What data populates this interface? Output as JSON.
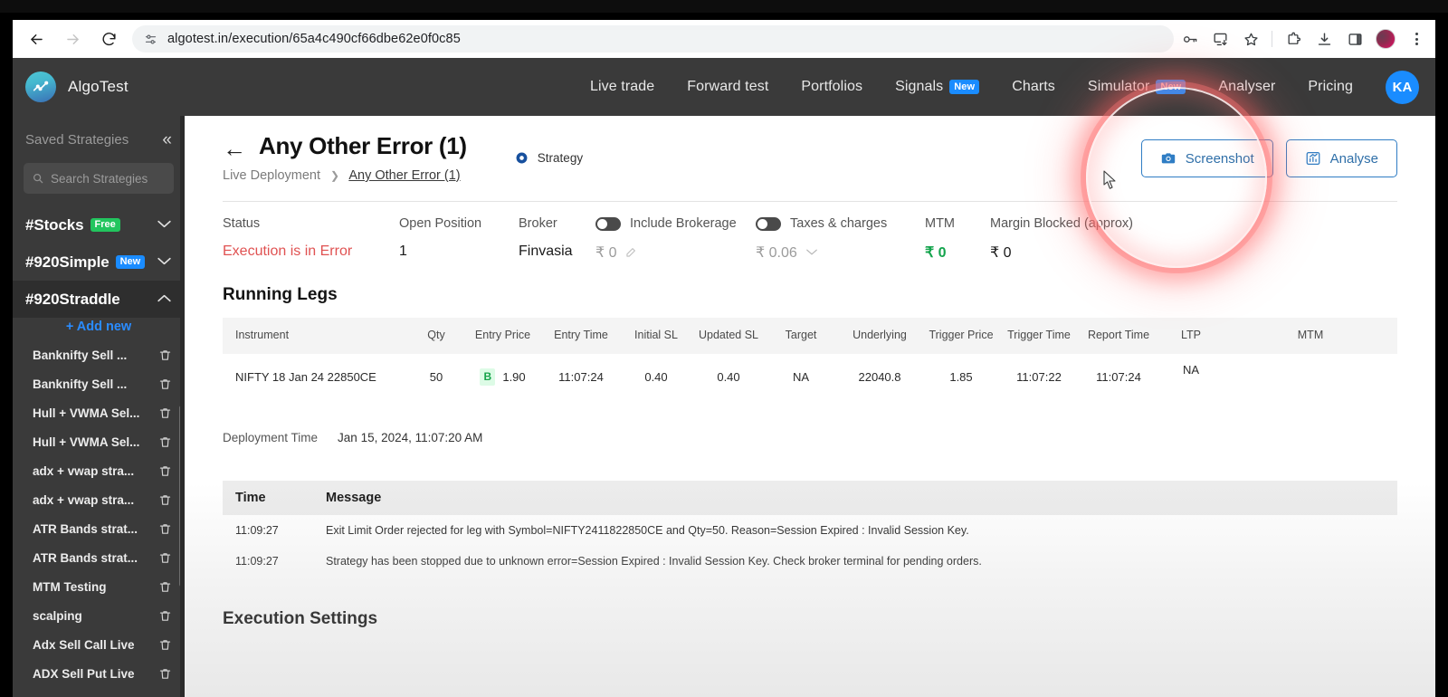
{
  "browser": {
    "url": "algotest.in/execution/65a4c490cf66dbe62e0f0c85",
    "back_icon": "back-arrow-icon",
    "forward_icon": "forward-arrow-icon",
    "reload_icon": "reload-icon",
    "site_info_icon": "site-settings-icon",
    "toolbar_icons": [
      "password-key-icon",
      "install-app-icon",
      "bookmark-star-icon",
      "extensions-puzzle-icon",
      "downloads-icon",
      "side-panel-icon",
      "profile-avatar-icon",
      "kebab-menu-icon"
    ]
  },
  "appnav": {
    "brand": "AlgoTest",
    "links": [
      {
        "label": "Live trade",
        "badge": ""
      },
      {
        "label": "Forward test",
        "badge": ""
      },
      {
        "label": "Portfolios",
        "badge": ""
      },
      {
        "label": "Signals",
        "badge": "New"
      },
      {
        "label": "Charts",
        "badge": ""
      },
      {
        "label": "Simulator",
        "badge": "New"
      },
      {
        "label": "Analyser",
        "badge": ""
      },
      {
        "label": "Pricing",
        "badge": ""
      }
    ],
    "avatar_initials": "KA"
  },
  "sidebar": {
    "title": "Saved Strategies",
    "collapse_glyph": "«",
    "search_placeholder": "Search Strategies",
    "groups": [
      {
        "label": "#Stocks",
        "badge": "Free",
        "badge_color": "#22c55e",
        "expanded": false
      },
      {
        "label": "#920Simple",
        "badge": "New",
        "badge_color": "#1a8cff",
        "expanded": false
      },
      {
        "label": "#920Straddle",
        "badge": "",
        "badge_color": "",
        "expanded": true
      }
    ],
    "add_new_label": "+ Add new",
    "items": [
      {
        "label": "Banknifty Sell ..."
      },
      {
        "label": "Banknifty Sell ..."
      },
      {
        "label": "Hull + VWMA Sel..."
      },
      {
        "label": "Hull + VWMA Sel..."
      },
      {
        "label": "adx + vwap stra..."
      },
      {
        "label": "adx + vwap stra..."
      },
      {
        "label": "ATR Bands strat..."
      },
      {
        "label": "ATR Bands strat..."
      },
      {
        "label": "MTM Testing"
      },
      {
        "label": "scalping"
      },
      {
        "label": "Adx Sell Call Live"
      },
      {
        "label": "ADX Sell Put Live"
      }
    ]
  },
  "header": {
    "back_glyph": "←",
    "title": "Any Other Error (1)",
    "breadcrumb_root": "Live Deployment",
    "breadcrumb_sep": "❯",
    "breadcrumb_current": "Any Other Error (1)",
    "strategy_tag": "Strategy",
    "screenshot_button": "Screenshot",
    "analyse_button": "Analyse",
    "accent_color": "#2f7dc4"
  },
  "stats": [
    {
      "name": "status",
      "label": "Status",
      "value": "Execution is in Error",
      "style": "err",
      "toggle": false,
      "pencil": false,
      "caret": false
    },
    {
      "name": "open-position",
      "label": "Open Position",
      "value": "1",
      "style": "",
      "toggle": false,
      "pencil": false,
      "caret": false
    },
    {
      "name": "broker",
      "label": "Broker",
      "value": "Finvasia",
      "style": "",
      "toggle": false,
      "pencil": false,
      "caret": false
    },
    {
      "name": "include-brokerage",
      "label": "Include Brokerage",
      "value": "₹ 0",
      "style": "muted",
      "toggle": true,
      "pencil": true,
      "caret": false
    },
    {
      "name": "taxes-charges",
      "label": "Taxes & charges",
      "value": "₹ 0.06",
      "style": "muted",
      "toggle": true,
      "pencil": false,
      "caret": true
    },
    {
      "name": "mtm",
      "label": "MTM",
      "value": "₹ 0",
      "style": "pos",
      "toggle": false,
      "pencil": false,
      "caret": false
    },
    {
      "name": "margin-blocked",
      "label": "Margin Blocked (approx)",
      "value": "₹ 0",
      "style": "",
      "toggle": false,
      "pencil": false,
      "caret": false
    }
  ],
  "running_legs": {
    "section_title": "Running Legs",
    "columns": [
      "Instrument",
      "Qty",
      "Entry Price",
      "Entry Time",
      "Initial SL",
      "Updated SL",
      "Target",
      "Underlying",
      "Trigger Price",
      "Trigger Time",
      "Report Time",
      "LTP",
      "MTM"
    ],
    "rows": [
      {
        "instrument": "NIFTY 18 Jan 24 22850CE",
        "qty": "50",
        "side": "B",
        "entry_price": "1.90",
        "entry_time": "11:07:24",
        "initial_sl": "0.40",
        "updated_sl": "0.40",
        "target": "NA",
        "underlying": "22040.8",
        "trigger_price": "1.85",
        "trigger_time": "11:07:22",
        "report_time": "11:07:24",
        "ltp": "NA",
        "mtm": ""
      }
    ]
  },
  "deployment": {
    "label": "Deployment Time",
    "value": "Jan 15, 2024, 11:07:20 AM"
  },
  "messages": {
    "columns": [
      "Time",
      "Message"
    ],
    "rows": [
      {
        "time": "11:09:27",
        "message": "Exit Limit Order rejected for leg with Symbol=NIFTY2411822850CE and Qty=50. Reason=Session Expired : Invalid Session Key."
      },
      {
        "time": "11:09:27",
        "message": "Strategy has been stopped due to unknown error=Session Expired : Invalid Session Key. Check broker terminal for pending orders."
      }
    ]
  },
  "execution_settings": {
    "title": "Execution Settings"
  }
}
